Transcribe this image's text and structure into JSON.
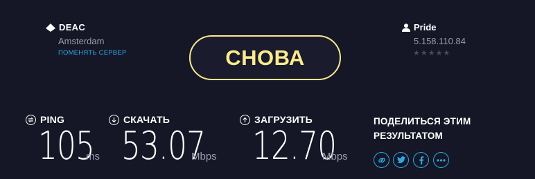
{
  "server": {
    "name": "DEAC",
    "location": "Amsterdam",
    "change_link": "ПОМЕНЯТЬ СЕРВЕР",
    "icon": "server-icon"
  },
  "again_button": {
    "label": "СНОВА",
    "color": "#fbeb8e"
  },
  "isp": {
    "name": "Pride",
    "ip": "5.158.110.84",
    "rating_stars": "★★★★★",
    "icon": "user-icon"
  },
  "metrics": {
    "ping": {
      "label": "PING",
      "value": "105",
      "unit": "ms",
      "icon": "ping-icon"
    },
    "download": {
      "label": "СКАЧАТЬ",
      "value": "53.07",
      "unit": "Mbps",
      "icon": "download-icon"
    },
    "upload": {
      "label": "ЗАГРУЗИТЬ",
      "value": "12.70",
      "unit": "Mbps",
      "icon": "upload-icon"
    }
  },
  "share": {
    "title_line1": "ПОДЕЛИТЬСЯ ЭТИМ",
    "title_line2": "РЕЗУЛЬТАТОМ",
    "buttons": [
      "link-icon",
      "twitter-icon",
      "facebook-icon",
      "more-icon"
    ]
  },
  "colors": {
    "background": "#161726",
    "accent": "#2aa9e6",
    "button": "#fbeb8e"
  }
}
